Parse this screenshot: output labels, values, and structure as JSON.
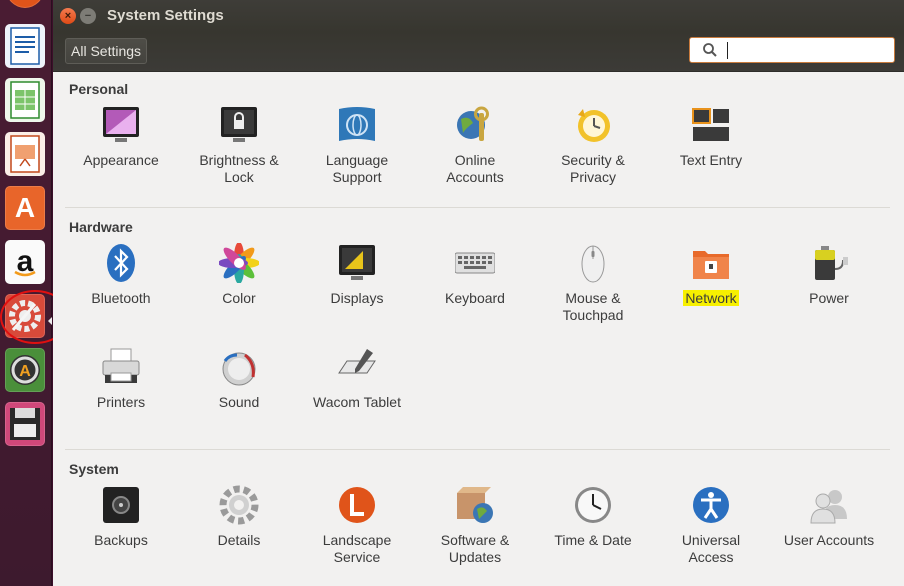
{
  "window": {
    "title": "System Settings"
  },
  "toolbar": {
    "all_settings_label": "All Settings",
    "search": {
      "value": "",
      "placeholder": ""
    }
  },
  "sections": {
    "personal": {
      "title": "Personal",
      "items": [
        {
          "label": "Appearance",
          "icon": "appearance-icon"
        },
        {
          "label": "Brightness &\nLock",
          "icon": "brightness-lock-icon"
        },
        {
          "label": "Language\nSupport",
          "icon": "language-support-icon"
        },
        {
          "label": "Online\nAccounts",
          "icon": "online-accounts-icon"
        },
        {
          "label": "Security &\nPrivacy",
          "icon": "security-privacy-icon"
        },
        {
          "label": "Text Entry",
          "icon": "text-entry-icon"
        }
      ]
    },
    "hardware": {
      "title": "Hardware",
      "items": [
        {
          "label": "Bluetooth",
          "icon": "bluetooth-icon"
        },
        {
          "label": "Color",
          "icon": "color-icon"
        },
        {
          "label": "Displays",
          "icon": "displays-icon"
        },
        {
          "label": "Keyboard",
          "icon": "keyboard-icon"
        },
        {
          "label": "Mouse &\nTouchpad",
          "icon": "mouse-touchpad-icon"
        },
        {
          "label": "Network",
          "icon": "network-icon",
          "highlighted": true
        },
        {
          "label": "Power",
          "icon": "power-icon"
        },
        {
          "label": "Printers",
          "icon": "printers-icon"
        },
        {
          "label": "Sound",
          "icon": "sound-icon"
        },
        {
          "label": "Wacom Tablet",
          "icon": "wacom-tablet-icon"
        }
      ]
    },
    "system": {
      "title": "System",
      "items": [
        {
          "label": "Backups",
          "icon": "backups-icon"
        },
        {
          "label": "Details",
          "icon": "details-icon"
        },
        {
          "label": "Landscape\nService",
          "icon": "landscape-service-icon"
        },
        {
          "label": "Software &\nUpdates",
          "icon": "software-updates-icon"
        },
        {
          "label": "Time & Date",
          "icon": "time-date-icon"
        },
        {
          "label": "Universal\nAccess",
          "icon": "universal-access-icon"
        },
        {
          "label": "User Accounts",
          "icon": "user-accounts-icon"
        }
      ]
    }
  },
  "launcher": {
    "items": [
      {
        "icon": "writer-icon"
      },
      {
        "icon": "calc-icon"
      },
      {
        "icon": "impress-icon"
      },
      {
        "icon": "software-center-icon"
      },
      {
        "icon": "amazon-icon"
      },
      {
        "icon": "system-settings-icon"
      },
      {
        "icon": "software-updater-icon"
      },
      {
        "icon": "floppy-icon"
      }
    ],
    "annotation_color": "#e01010",
    "highlight_color": "#f7f000"
  }
}
